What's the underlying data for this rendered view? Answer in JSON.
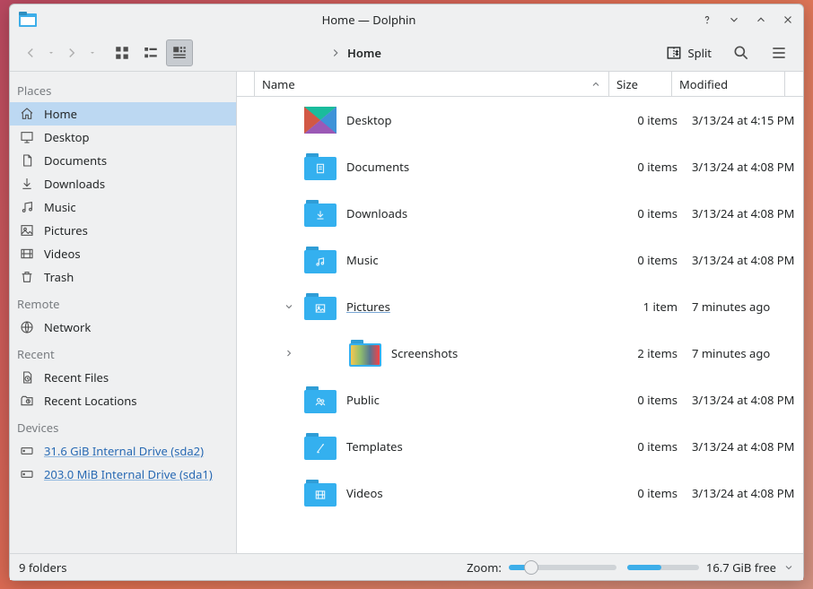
{
  "window": {
    "title": "Home — Dolphin"
  },
  "toolbar": {
    "split_label": "Split"
  },
  "breadcrumb": {
    "current": "Home"
  },
  "columns": {
    "name": "Name",
    "size": "Size",
    "modified": "Modified"
  },
  "sidebar": {
    "sections": [
      {
        "heading": "Places",
        "items": [
          {
            "label": "Home",
            "icon": "home",
            "active": true
          },
          {
            "label": "Desktop",
            "icon": "desktop"
          },
          {
            "label": "Documents",
            "icon": "documents"
          },
          {
            "label": "Downloads",
            "icon": "downloads"
          },
          {
            "label": "Music",
            "icon": "music"
          },
          {
            "label": "Pictures",
            "icon": "pictures"
          },
          {
            "label": "Videos",
            "icon": "videos"
          },
          {
            "label": "Trash",
            "icon": "trash"
          }
        ]
      },
      {
        "heading": "Remote",
        "items": [
          {
            "label": "Network",
            "icon": "network"
          }
        ]
      },
      {
        "heading": "Recent",
        "items": [
          {
            "label": "Recent Files",
            "icon": "recent-files"
          },
          {
            "label": "Recent Locations",
            "icon": "recent-locations"
          }
        ]
      },
      {
        "heading": "Devices",
        "items": [
          {
            "label": "31.6 GiB Internal Drive (sda2)",
            "icon": "drive",
            "link": true
          },
          {
            "label": "203.0 MiB Internal Drive (sda1)",
            "icon": "drive",
            "link": true
          }
        ]
      }
    ]
  },
  "files": [
    {
      "name": "Desktop",
      "size": "0 items",
      "modified": "3/13/24 at 4:15 PM",
      "icon": "desktop-folder"
    },
    {
      "name": "Documents",
      "size": "0 items",
      "modified": "3/13/24 at 4:08 PM",
      "icon": "documents-folder"
    },
    {
      "name": "Downloads",
      "size": "0 items",
      "modified": "3/13/24 at 4:08 PM",
      "icon": "downloads-folder"
    },
    {
      "name": "Music",
      "size": "0 items",
      "modified": "3/13/24 at 4:08 PM",
      "icon": "music-folder"
    },
    {
      "name": "Pictures",
      "size": "1 item",
      "modified": "7 minutes ago",
      "icon": "pictures-folder",
      "expanded": true,
      "underline": true
    },
    {
      "name": "Screenshots",
      "size": "2 items",
      "modified": "7 minutes ago",
      "icon": "screenshots-folder",
      "child": true
    },
    {
      "name": "Public",
      "size": "0 items",
      "modified": "3/13/24 at 4:08 PM",
      "icon": "public-folder"
    },
    {
      "name": "Templates",
      "size": "0 items",
      "modified": "3/13/24 at 4:08 PM",
      "icon": "templates-folder"
    },
    {
      "name": "Videos",
      "size": "0 items",
      "modified": "3/13/24 at 4:08 PM",
      "icon": "videos-folder"
    }
  ],
  "status": {
    "count": "9 folders",
    "zoom_label": "Zoom:",
    "free": "16.7 GiB free"
  }
}
